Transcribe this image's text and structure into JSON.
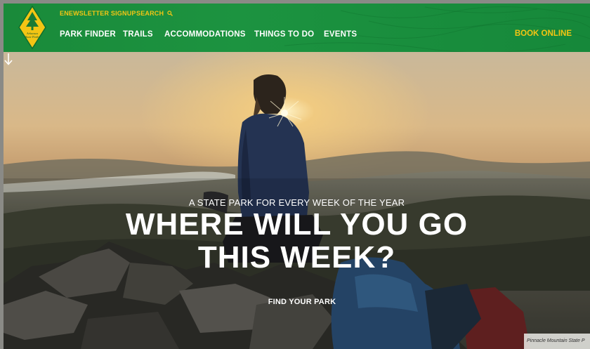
{
  "header": {
    "logo_text": "Arkansas State Parks",
    "utility_links": [
      {
        "label": "ENEWSLETTER SIGNUP"
      },
      {
        "label": "SEARCH"
      }
    ],
    "nav": [
      {
        "label": "PARK FINDER"
      },
      {
        "label": "TRAILS"
      },
      {
        "label": "ACCOMMODATIONS"
      },
      {
        "label": "THINGS TO DO"
      },
      {
        "label": "EVENTS"
      }
    ],
    "book_label": "BOOK ONLINE"
  },
  "hero": {
    "eyebrow": "A STATE PARK FOR EVERY WEEK OF THE YEAR",
    "headline_line1": "WHERE WILL YOU GO",
    "headline_line2": "THIS WEEK?",
    "cta_label": "FIND YOUR PARK",
    "photo_caption": "Pinnacle Mountain State P"
  },
  "colors": {
    "brand_green": "#1c9340",
    "accent_yellow": "#f3c514",
    "text_white": "#ffffff"
  },
  "icons": [
    "logo-icon",
    "search-icon",
    "arrow-down-icon"
  ]
}
